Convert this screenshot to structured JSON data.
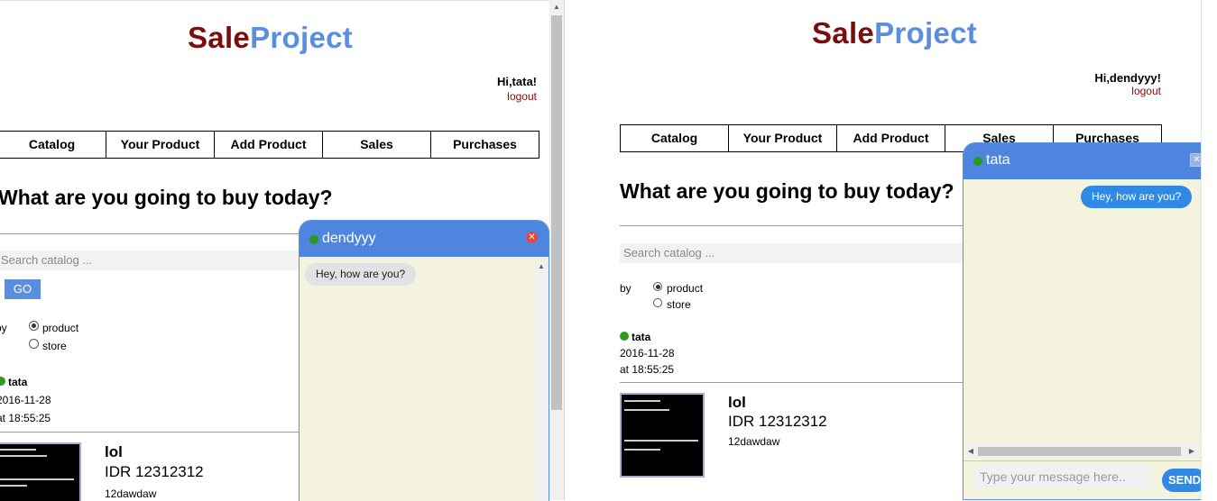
{
  "left": {
    "brand": {
      "sale": "Sale",
      "project": "Project"
    },
    "greeting": "Hi,tata!",
    "logout": "logout",
    "nav": [
      "Catalog",
      "Your Product",
      "Add Product",
      "Sales",
      "Purchases"
    ],
    "heading": "What are you going to buy today?",
    "search": {
      "placeholder": "Search catalog ...",
      "button": "GO"
    },
    "by_label": "by",
    "options": [
      "product",
      "store"
    ],
    "selected_option": "product",
    "seller": {
      "name": "tata",
      "date": "2016-11-28",
      "time": "at 18:55:25"
    },
    "product": {
      "name": "lol",
      "price": "IDR 12312312",
      "desc": "12dawdaw"
    },
    "chat": {
      "name": "dendyyy",
      "messages": [
        {
          "text": "Hey, how are you?",
          "direction": "in"
        }
      ]
    }
  },
  "right": {
    "brand": {
      "sale": "Sale",
      "project": "Project"
    },
    "greeting": "Hi,dendyyy!",
    "logout": "logout",
    "nav": [
      "Catalog",
      "Your Product",
      "Add Product",
      "Sales",
      "Purchases"
    ],
    "heading": "What are you going to buy today?",
    "search": {
      "placeholder": "Search catalog ..."
    },
    "by_label": "by",
    "options": [
      "product",
      "store"
    ],
    "selected_option": "product",
    "seller": {
      "name": "tata",
      "date": "2016-11-28",
      "time": "at 18:55:25"
    },
    "product": {
      "name": "lol",
      "price": "IDR 12312312",
      "desc": "12dawdaw"
    },
    "chat": {
      "name": "tata",
      "messages": [
        {
          "text": "Hey, how are you?",
          "direction": "out"
        }
      ],
      "input_placeholder": "Type your message here..",
      "send": "SEND"
    }
  }
}
